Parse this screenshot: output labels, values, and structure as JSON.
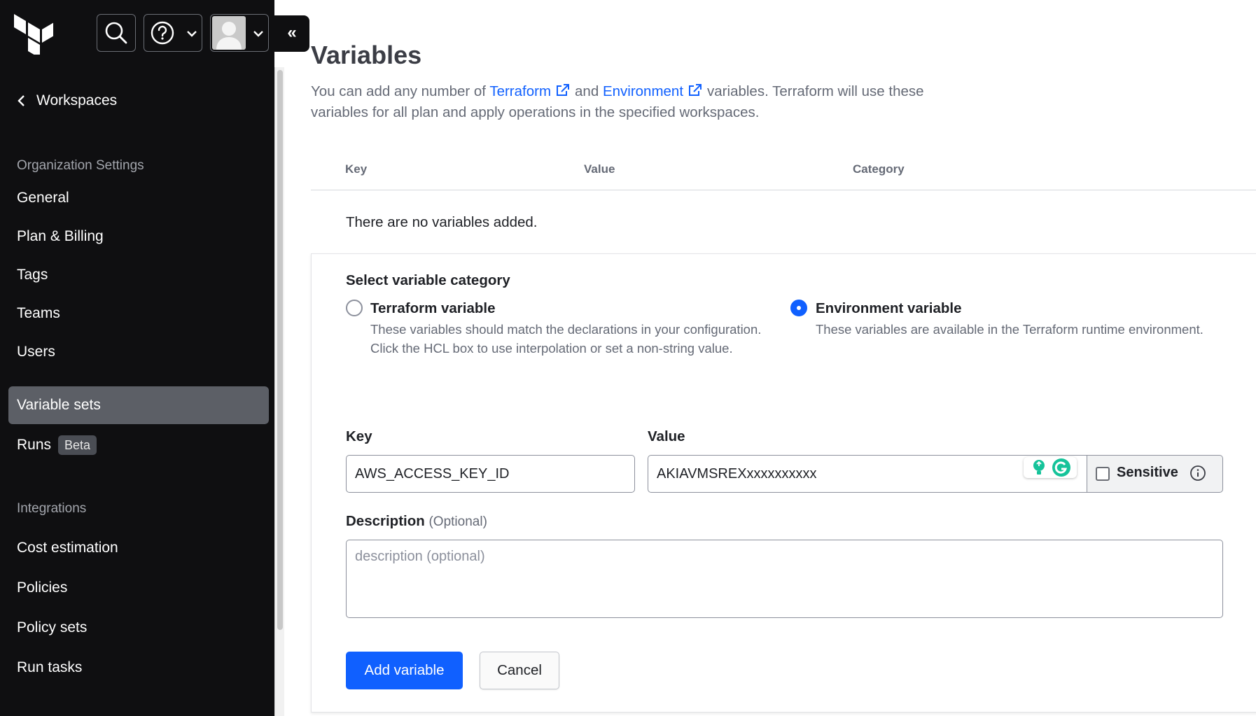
{
  "sidebar": {
    "back_label": "Workspaces",
    "org_section": "Organization Settings",
    "org_items": [
      {
        "label": "General"
      },
      {
        "label": "Plan & Billing"
      },
      {
        "label": "Tags"
      },
      {
        "label": "Teams"
      },
      {
        "label": "Users"
      },
      {
        "label": "Variable sets",
        "active": true
      },
      {
        "label": "Runs",
        "badge": "Beta"
      }
    ],
    "integrations_section": "Integrations",
    "integration_items": [
      {
        "label": "Cost estimation"
      },
      {
        "label": "Policies"
      },
      {
        "label": "Policy sets"
      },
      {
        "label": "Run tasks"
      }
    ],
    "collapse_glyph": "«"
  },
  "main": {
    "title": "Variables",
    "intro": {
      "part1": "You can add any number of ",
      "link1": "Terraform",
      "part2": "and ",
      "link2": "Environment",
      "part3": "variables. Terraform will use these variables for all plan and apply operations in the specified workspaces."
    },
    "table": {
      "headers": [
        "Key",
        "Value",
        "Category"
      ],
      "empty_text": "There are no variables added."
    },
    "form": {
      "category_label": "Select variable category",
      "options": [
        {
          "title": "Terraform variable",
          "desc": "These variables should match the declarations in your configuration. Click the HCL box to use interpolation or set a non-string value.",
          "selected": false
        },
        {
          "title": "Environment variable",
          "desc": "These variables are available in the Terraform runtime environment.",
          "selected": true
        }
      ],
      "key_label": "Key",
      "key_value": "AWS_ACCESS_KEY_ID",
      "value_label": "Value",
      "value_value": "AKIAVMSREXxxxxxxxxxx",
      "sensitive_label": "Sensitive",
      "description_label": "Description",
      "description_optional": "(Optional)",
      "description_placeholder": "description (optional)",
      "submit_label": "Add variable",
      "cancel_label": "Cancel"
    }
  },
  "colors": {
    "sidebar_bg": "#0f0f11",
    "active_item": "#5c5f66",
    "accent": "#1060ff",
    "muted_text": "#656a76"
  }
}
